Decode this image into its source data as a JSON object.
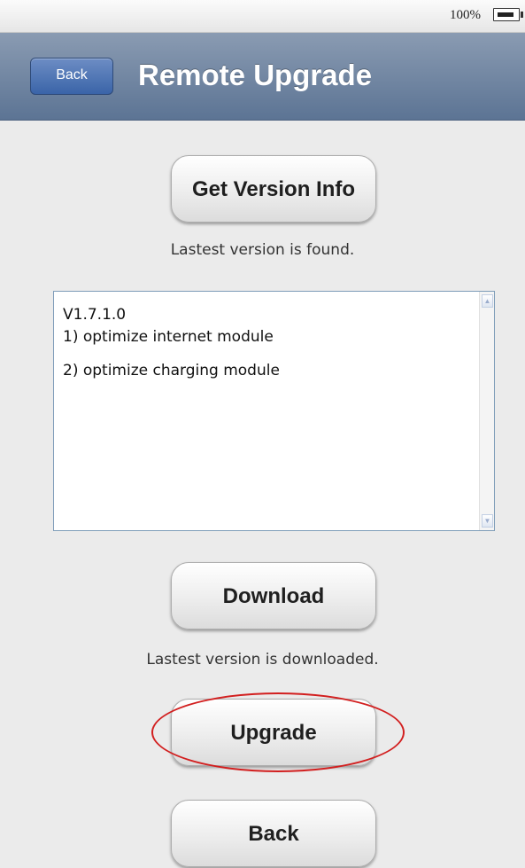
{
  "status_bar": {
    "battery_percent": "100%"
  },
  "nav": {
    "back_label": "Back",
    "title": "Remote Upgrade"
  },
  "version_section": {
    "get_version_label": "Get Version Info",
    "status": "Lastest version is found."
  },
  "release_notes": {
    "version": "V1.7.1.0",
    "lines": [
      "1) optimize internet module",
      "2) optimize charging module"
    ]
  },
  "download_section": {
    "download_label": "Download",
    "status": "Lastest version is downloaded."
  },
  "upgrade_section": {
    "upgrade_label": "Upgrade",
    "highlight_color": "#d21f1f"
  },
  "footer": {
    "back_label": "Back"
  },
  "colors": {
    "nav_bar": "#6e829f",
    "nav_back_button": "#4a70b0",
    "background": "#ebebeb"
  }
}
